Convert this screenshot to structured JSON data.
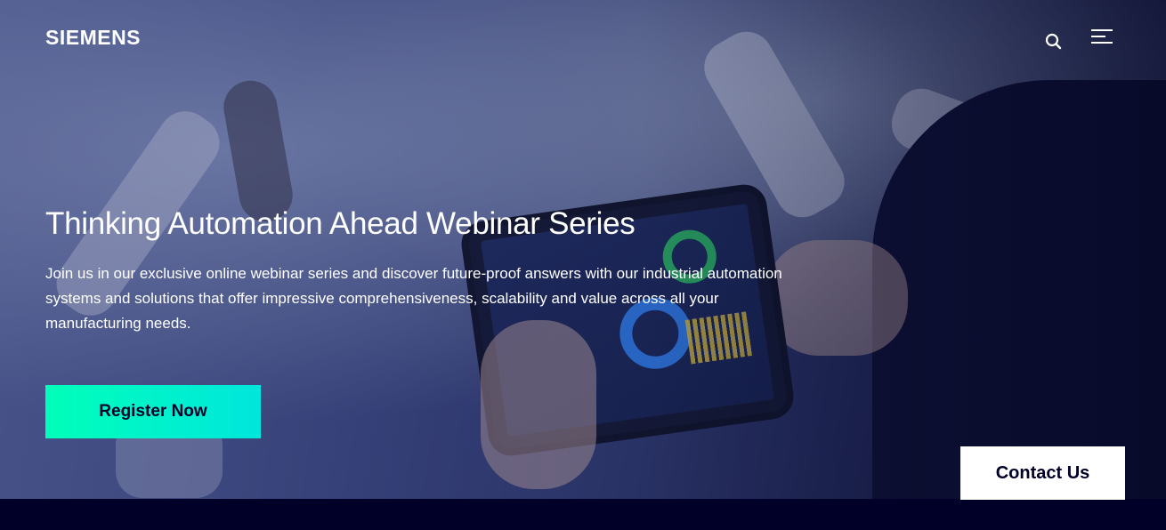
{
  "header": {
    "logo_text": "SIEMENS",
    "search_icon": "search-icon",
    "menu_icon": "menu-icon"
  },
  "hero": {
    "title": "Thinking Automation Ahead Webinar Series",
    "description": "Join us in our exclusive online webinar series and discover future-proof answers with our industrial automation systems and solutions that offer impressive comprehensiveness, scalability and value across all your manufacturing needs.",
    "cta_label": "Register Now",
    "cta_gradient": [
      "#00ffb9",
      "#00e6dc"
    ]
  },
  "contact": {
    "label": "Contact Us"
  },
  "colors": {
    "brand_dark": "#000028",
    "text_light": "#ffffff"
  }
}
